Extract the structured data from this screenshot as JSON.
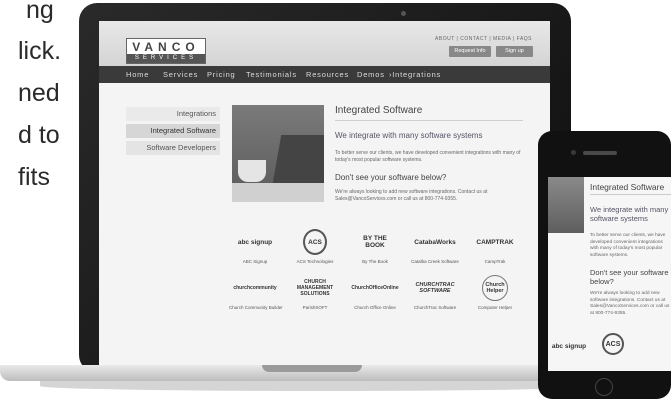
{
  "left_fragments": [
    "ng",
    "lick.",
    "ned",
    "d to",
    "fits"
  ],
  "site": {
    "logo_main": "VANCO",
    "logo_sub": "SERVICES",
    "top_links": "ABOUT  |  CONTACT  |  MEDIA  |  FAQS",
    "request_button": "Request Info",
    "signup_button": "Sign up"
  },
  "nav": {
    "items": [
      "Home",
      "Services",
      "Pricing",
      "Testimonials",
      "Resources",
      "Demos",
      "›Integrations"
    ]
  },
  "sidebar": {
    "items": [
      "Integrations",
      "Integrated Software",
      "Software Developers"
    ]
  },
  "main": {
    "title": "Integrated Software",
    "subhead": "We integrate with many software systems",
    "para": "To better serve our clients, we have developed convenient integrations with many of today's most popular software systems.",
    "question": "Don't see your software below?",
    "para2": "We're always looking to add new software integrations. Contact us at Sales@VancoServices.com or call us at 800-774-9355."
  },
  "logos": [
    {
      "mark": "abc signup",
      "caption": "ABC Signup"
    },
    {
      "mark": "ACS",
      "caption": "ACS Technologies"
    },
    {
      "mark": "BY THE BOOK",
      "caption": "By The Book"
    },
    {
      "mark": "CatabaWorks",
      "caption": "Catalba Creek Software"
    },
    {
      "mark": "CAMPTRAK",
      "caption": "CampTrak"
    },
    {
      "mark": "churchcommunity",
      "caption": "Church Community Builder"
    },
    {
      "mark": "CHURCH MANAGEMENT SOLUTIONS",
      "caption": "ParishSOFT"
    },
    {
      "mark": "ChurchOfficeOnline",
      "caption": "Church Office Online"
    },
    {
      "mark": "CHURCHTRAC SOFTWARE",
      "caption": "ChurchTrac Software"
    },
    {
      "mark": "Church Helper",
      "caption": "Computer Helper"
    }
  ],
  "phone": {
    "title": "Integrated Software",
    "subhead": "We integrate with many software systems",
    "para": "To better serve our clients, we have developed convenient integrations with many of today's most popular software systems.",
    "question": "Don't see your software below?",
    "para2": "We're always looking to add new software integrations. Contact us at Sales@VancoServices.com or call us at 800-774-9355.",
    "logo1": "abc signup",
    "logo2": "ACS"
  }
}
